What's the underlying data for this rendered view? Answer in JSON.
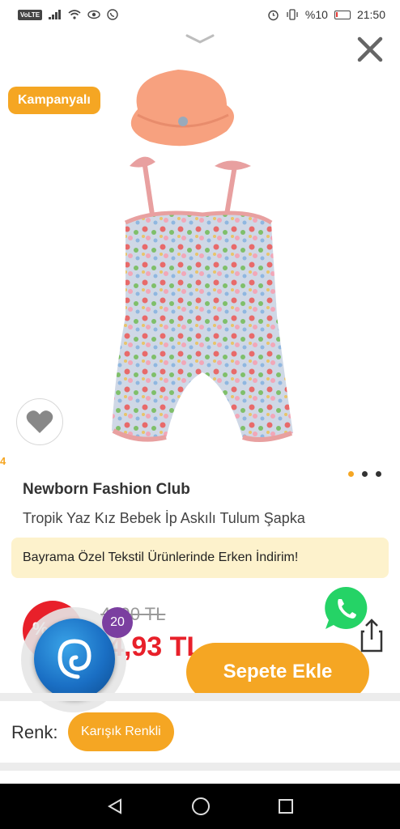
{
  "status_bar": {
    "left_icons": [
      "volte-icon",
      "signal-icon",
      "wifi-icon",
      "eye-icon",
      "whatsapp-status-icon"
    ],
    "volte": "VoLTE",
    "battery_text": "%10",
    "time": "21:50"
  },
  "header": {
    "collapse_icon": "chevron-down-icon",
    "close_icon": "close-icon"
  },
  "badges": {
    "campaign": "Kampanyalı"
  },
  "gallery": {
    "side_number": "4",
    "dots": 3,
    "active_dot": 0
  },
  "product": {
    "brand": "Newborn Fashion Club",
    "title": "Tropik Yaz Kız Bebek İp Askılı Tulum Şapka",
    "promo": "Bayrama Özel Tekstil Ürünlerinde Erken İndirim!",
    "discount": "%",
    "old_price": "4 ,90 TL",
    "new_price": "4,93 TL",
    "notification_count": "20"
  },
  "actions": {
    "add_to_cart": "Sepete Ekle"
  },
  "variant": {
    "label": "Renk:",
    "value": "Karışık Renkli"
  },
  "colors": {
    "accent": "#f5a623",
    "price_red": "#e8202a",
    "promo_bg": "#fdf2cc",
    "whatsapp": "#25d366"
  }
}
